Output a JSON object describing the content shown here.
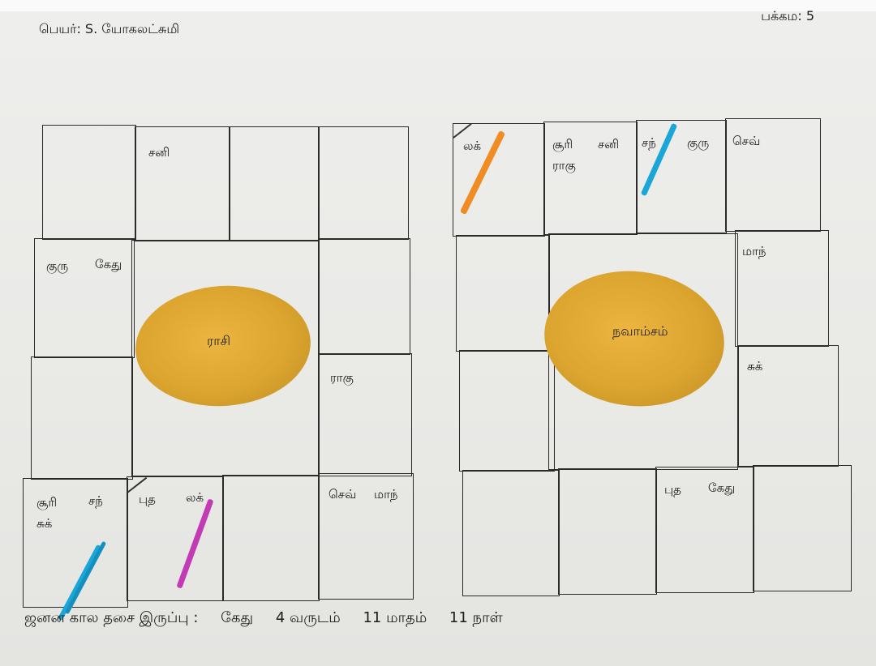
{
  "header": {
    "name_line": "பெயர்: S. யோகலட்சுமி",
    "page_number": "பக்கம: 5"
  },
  "rasi_chart": {
    "center_label": "ராசி",
    "cells": {
      "r1c2": "சனி",
      "r2c1": [
        "குரு",
        "கேது"
      ],
      "r3c4": "ராகு",
      "r4c1_line1": [
        "சூரி",
        "சந்"
      ],
      "r4c1_line2": "சுக்",
      "r4c2": [
        "புத",
        "லக்"
      ],
      "r4c4": [
        "செவ்",
        "மாந்"
      ]
    }
  },
  "navamsa_chart": {
    "center_label": "நவாம்சம்",
    "cells": {
      "r1c1": "லக்",
      "r1c2_line1": [
        "சூரி",
        "சனி"
      ],
      "r1c2_line2": "ராகு",
      "r1c3": [
        "சந்",
        "குரு"
      ],
      "r1c4": "செவ்",
      "r2c4": "மாந்",
      "r3c4": "சுக்",
      "r4c3": [
        "புத",
        "கேது"
      ]
    }
  },
  "footer": {
    "label": "ஜனன கால தசை இருப்பு :",
    "dasa": "கேது",
    "years": "4 வருடம்",
    "months": "11 மாதம்",
    "days": "11 நாள்"
  },
  "colors": {
    "ink": "#1c1c1c",
    "turmeric": "#dca52f",
    "orange_marker": "#f08c24",
    "blue_marker": "#1aa6d6",
    "magenta_marker": "#c23ab4"
  }
}
